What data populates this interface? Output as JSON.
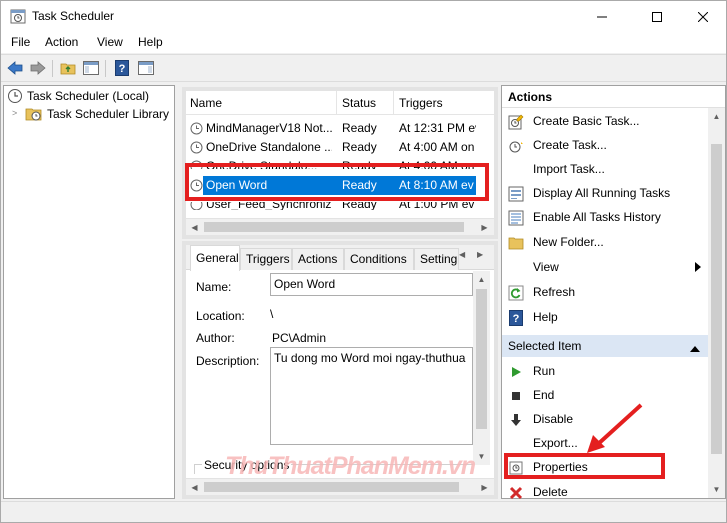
{
  "window": {
    "title": "Task Scheduler"
  },
  "menu": [
    "File",
    "Action",
    "View",
    "Help"
  ],
  "tree": {
    "root": "Task Scheduler (Local)",
    "child": "Task Scheduler Library"
  },
  "tasks": {
    "columns": [
      "Name",
      "Status",
      "Triggers"
    ],
    "rows": [
      {
        "name": "MindManagerV18 Not...",
        "status": "Ready",
        "trigger": "At 12:31 PM ev"
      },
      {
        "name": "OneDrive Standalone ...",
        "status": "Ready",
        "trigger": "At 4:00 AM on"
      },
      {
        "name": "OneDrive Standalo...",
        "status": "Ready",
        "trigger": "At 4:00 AM on"
      },
      {
        "name": "Open Word",
        "status": "Ready",
        "trigger": "At 8:10 AM ev"
      },
      {
        "name": "User_Feed_Synchroniz...",
        "status": "Ready",
        "trigger": "At 1:00 PM ev"
      }
    ],
    "selected_index": 3
  },
  "details": {
    "tabs": [
      "General",
      "Triggers",
      "Actions",
      "Conditions",
      "Setting"
    ],
    "active_tab": "General",
    "name_label": "Name:",
    "name_value": "Open Word",
    "location_label": "Location:",
    "location_value": "\\",
    "author_label": "Author:",
    "author_value": "PC\\Admin",
    "description_label": "Description:",
    "description_value": "Tu dong mo Word moi ngay-thuthua",
    "security_label": "Security options"
  },
  "actions": {
    "header": "Actions",
    "items": [
      {
        "label": "Create Basic Task...",
        "icon": "create-basic-task-icon"
      },
      {
        "label": "Create Task...",
        "icon": "create-task-icon"
      },
      {
        "label": "Import Task...",
        "icon": ""
      },
      {
        "label": "Display All Running Tasks",
        "icon": "running-tasks-icon"
      },
      {
        "label": "Enable All Tasks History",
        "icon": "tasks-history-icon"
      },
      {
        "label": "New Folder...",
        "icon": "folder-icon"
      },
      {
        "label": "View",
        "icon": ""
      },
      {
        "label": "Refresh",
        "icon": "refresh-icon"
      },
      {
        "label": "Help",
        "icon": "help-icon"
      }
    ],
    "selected_header": "Selected Item",
    "selected_items": [
      {
        "label": "Run",
        "icon": "run-icon"
      },
      {
        "label": "End",
        "icon": "end-icon"
      },
      {
        "label": "Disable",
        "icon": "disable-icon"
      },
      {
        "label": "Export...",
        "icon": ""
      },
      {
        "label": "Properties",
        "icon": "properties-icon"
      },
      {
        "label": "Delete",
        "icon": "delete-icon"
      }
    ]
  },
  "watermark": "ThuThuatPhanMem.vn",
  "colors": {
    "selection": "#0078d7",
    "highlight_box": "#e41f1f",
    "arrow": "#e41f1f",
    "section_header": "#dbe6f4"
  }
}
